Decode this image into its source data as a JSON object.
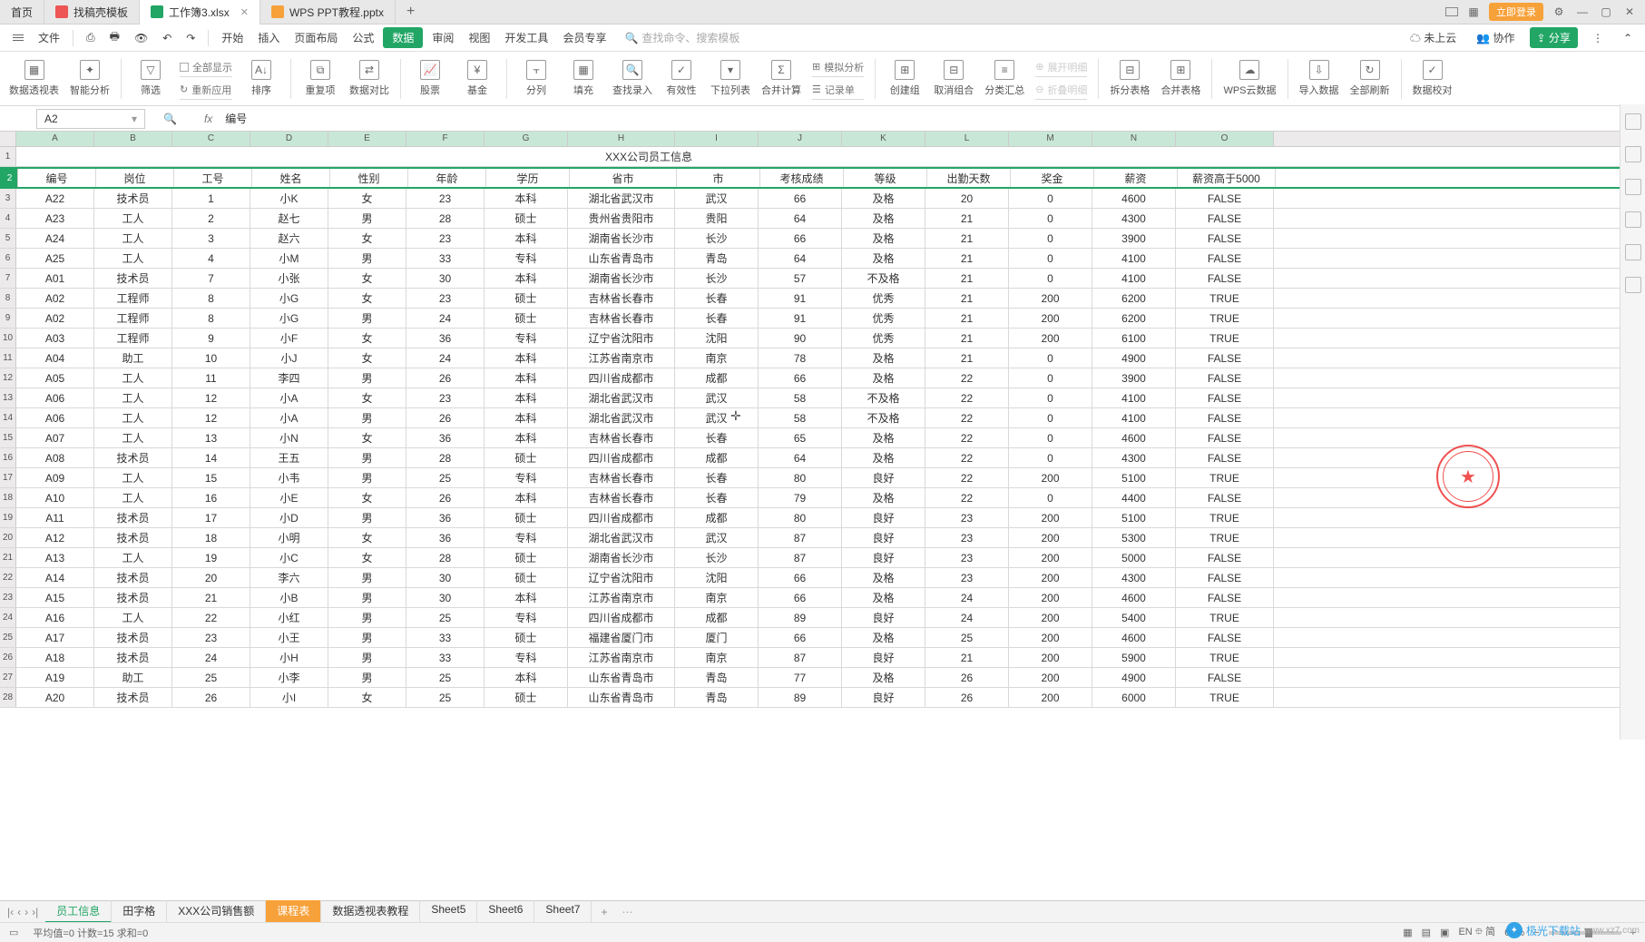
{
  "tabs": {
    "home": "首页",
    "t1": "找稿壳模板",
    "t2": "工作簿3.xlsx",
    "t3": "WPS PPT教程.pptx"
  },
  "login": "立即登录",
  "menu": {
    "file": "文件",
    "items": [
      "开始",
      "插入",
      "页面布局",
      "公式",
      "数据",
      "审阅",
      "视图",
      "开发工具",
      "会员专享"
    ],
    "active": "数据",
    "search_placeholder": "查找命令、搜索模板",
    "cloud": "未上云",
    "coop": "协作",
    "share": "分享"
  },
  "ribbon": {
    "r1": "数据透视表",
    "r2": "智能分析",
    "r3": "筛选",
    "r3a": "全部显示",
    "r3b": "重新应用",
    "r4": "排序",
    "r5": "重复项",
    "r6": "数据对比",
    "r7": "股票",
    "r8": "基金",
    "r9": "分列",
    "r10": "填充",
    "r11": "查找录入",
    "r12": "有效性",
    "r13": "下拉列表",
    "r14": "合并计算",
    "r14a": "模拟分析",
    "r14b": "记录单",
    "r15": "创建组",
    "r16": "取消组合",
    "r17": "分类汇总",
    "r17a": "展开明细",
    "r17b": "折叠明细",
    "r18": "拆分表格",
    "r19": "合并表格",
    "r20": "WPS云数据",
    "r21": "导入数据",
    "r22": "全部刷新",
    "r23": "数据校对"
  },
  "fx": {
    "cell": "A2",
    "label": "fx",
    "value": "编号"
  },
  "colLetters": [
    "A",
    "B",
    "C",
    "D",
    "E",
    "F",
    "G",
    "H",
    "I",
    "J",
    "K",
    "L",
    "M",
    "N",
    "O"
  ],
  "title": "XXX公司员工信息",
  "headers": [
    "编号",
    "岗位",
    "工号",
    "姓名",
    "性别",
    "年龄",
    "学历",
    "省市",
    "市",
    "考核成绩",
    "等级",
    "出勤天数",
    "奖金",
    "薪资",
    "薪资高于5000"
  ],
  "rows": [
    [
      "A22",
      "技术员",
      "1",
      "小K",
      "女",
      "23",
      "本科",
      "湖北省武汉市",
      "武汉",
      "66",
      "及格",
      "20",
      "0",
      "4600",
      "FALSE"
    ],
    [
      "A23",
      "工人",
      "2",
      "赵七",
      "男",
      "28",
      "硕士",
      "贵州省贵阳市",
      "贵阳",
      "64",
      "及格",
      "21",
      "0",
      "4300",
      "FALSE"
    ],
    [
      "A24",
      "工人",
      "3",
      "赵六",
      "女",
      "23",
      "本科",
      "湖南省长沙市",
      "长沙",
      "66",
      "及格",
      "21",
      "0",
      "3900",
      "FALSE"
    ],
    [
      "A25",
      "工人",
      "4",
      "小M",
      "男",
      "33",
      "专科",
      "山东省青岛市",
      "青岛",
      "64",
      "及格",
      "21",
      "0",
      "4100",
      "FALSE"
    ],
    [
      "A01",
      "技术员",
      "7",
      "小张",
      "女",
      "30",
      "本科",
      "湖南省长沙市",
      "长沙",
      "57",
      "不及格",
      "21",
      "0",
      "4100",
      "FALSE"
    ],
    [
      "A02",
      "工程师",
      "8",
      "小G",
      "女",
      "23",
      "硕士",
      "吉林省长春市",
      "长春",
      "91",
      "优秀",
      "21",
      "200",
      "6200",
      "TRUE"
    ],
    [
      "A02",
      "工程师",
      "8",
      "小G",
      "男",
      "24",
      "硕士",
      "吉林省长春市",
      "长春",
      "91",
      "优秀",
      "21",
      "200",
      "6200",
      "TRUE"
    ],
    [
      "A03",
      "工程师",
      "9",
      "小F",
      "女",
      "36",
      "专科",
      "辽宁省沈阳市",
      "沈阳",
      "90",
      "优秀",
      "21",
      "200",
      "6100",
      "TRUE"
    ],
    [
      "A04",
      "助工",
      "10",
      "小J",
      "女",
      "24",
      "本科",
      "江苏省南京市",
      "南京",
      "78",
      "及格",
      "21",
      "0",
      "4900",
      "FALSE"
    ],
    [
      "A05",
      "工人",
      "11",
      "李四",
      "男",
      "26",
      "本科",
      "四川省成都市",
      "成都",
      "66",
      "及格",
      "22",
      "0",
      "3900",
      "FALSE"
    ],
    [
      "A06",
      "工人",
      "12",
      "小A",
      "女",
      "23",
      "本科",
      "湖北省武汉市",
      "武汉",
      "58",
      "不及格",
      "22",
      "0",
      "4100",
      "FALSE"
    ],
    [
      "A06",
      "工人",
      "12",
      "小A",
      "男",
      "26",
      "本科",
      "湖北省武汉市",
      "武汉",
      "58",
      "不及格",
      "22",
      "0",
      "4100",
      "FALSE"
    ],
    [
      "A07",
      "工人",
      "13",
      "小N",
      "女",
      "36",
      "本科",
      "吉林省长春市",
      "长春",
      "65",
      "及格",
      "22",
      "0",
      "4600",
      "FALSE"
    ],
    [
      "A08",
      "技术员",
      "14",
      "王五",
      "男",
      "28",
      "硕士",
      "四川省成都市",
      "成都",
      "64",
      "及格",
      "22",
      "0",
      "4300",
      "FALSE"
    ],
    [
      "A09",
      "工人",
      "15",
      "小韦",
      "男",
      "25",
      "专科",
      "吉林省长春市",
      "长春",
      "80",
      "良好",
      "22",
      "200",
      "5100",
      "TRUE"
    ],
    [
      "A10",
      "工人",
      "16",
      "小E",
      "女",
      "26",
      "本科",
      "吉林省长春市",
      "长春",
      "79",
      "及格",
      "22",
      "0",
      "4400",
      "FALSE"
    ],
    [
      "A11",
      "技术员",
      "17",
      "小D",
      "男",
      "36",
      "硕士",
      "四川省成都市",
      "成都",
      "80",
      "良好",
      "23",
      "200",
      "5100",
      "TRUE"
    ],
    [
      "A12",
      "技术员",
      "18",
      "小明",
      "女",
      "36",
      "专科",
      "湖北省武汉市",
      "武汉",
      "87",
      "良好",
      "23",
      "200",
      "5300",
      "TRUE"
    ],
    [
      "A13",
      "工人",
      "19",
      "小C",
      "女",
      "28",
      "硕士",
      "湖南省长沙市",
      "长沙",
      "87",
      "良好",
      "23",
      "200",
      "5000",
      "FALSE"
    ],
    [
      "A14",
      "技术员",
      "20",
      "李六",
      "男",
      "30",
      "硕士",
      "辽宁省沈阳市",
      "沈阳",
      "66",
      "及格",
      "23",
      "200",
      "4300",
      "FALSE"
    ],
    [
      "A15",
      "技术员",
      "21",
      "小B",
      "男",
      "30",
      "本科",
      "江苏省南京市",
      "南京",
      "66",
      "及格",
      "24",
      "200",
      "4600",
      "FALSE"
    ],
    [
      "A16",
      "工人",
      "22",
      "小红",
      "男",
      "25",
      "专科",
      "四川省成都市",
      "成都",
      "89",
      "良好",
      "24",
      "200",
      "5400",
      "TRUE"
    ],
    [
      "A17",
      "技术员",
      "23",
      "小王",
      "男",
      "33",
      "硕士",
      "福建省厦门市",
      "厦门",
      "66",
      "及格",
      "25",
      "200",
      "4600",
      "FALSE"
    ],
    [
      "A18",
      "技术员",
      "24",
      "小H",
      "男",
      "33",
      "专科",
      "江苏省南京市",
      "南京",
      "87",
      "良好",
      "21",
      "200",
      "5900",
      "TRUE"
    ],
    [
      "A19",
      "助工",
      "25",
      "小李",
      "男",
      "25",
      "本科",
      "山东省青岛市",
      "青岛",
      "77",
      "及格",
      "26",
      "200",
      "4900",
      "FALSE"
    ],
    [
      "A20",
      "技术员",
      "26",
      "小I",
      "女",
      "25",
      "硕士",
      "山东省青岛市",
      "青岛",
      "89",
      "良好",
      "26",
      "200",
      "6000",
      "TRUE"
    ]
  ],
  "sheets": {
    "list": [
      "员工信息",
      "田字格",
      "XXX公司销售额",
      "课程表",
      "数据透视表教程",
      "Sheet5",
      "Sheet6",
      "Sheet7"
    ],
    "active": 0,
    "highlight": 3
  },
  "status": {
    "stats": "平均值=0  计数=15  求和=0",
    "ime": "EN",
    "zoom": "60%"
  },
  "watermark": {
    "site": "极光下载站",
    "url": "www.xz7.com"
  }
}
